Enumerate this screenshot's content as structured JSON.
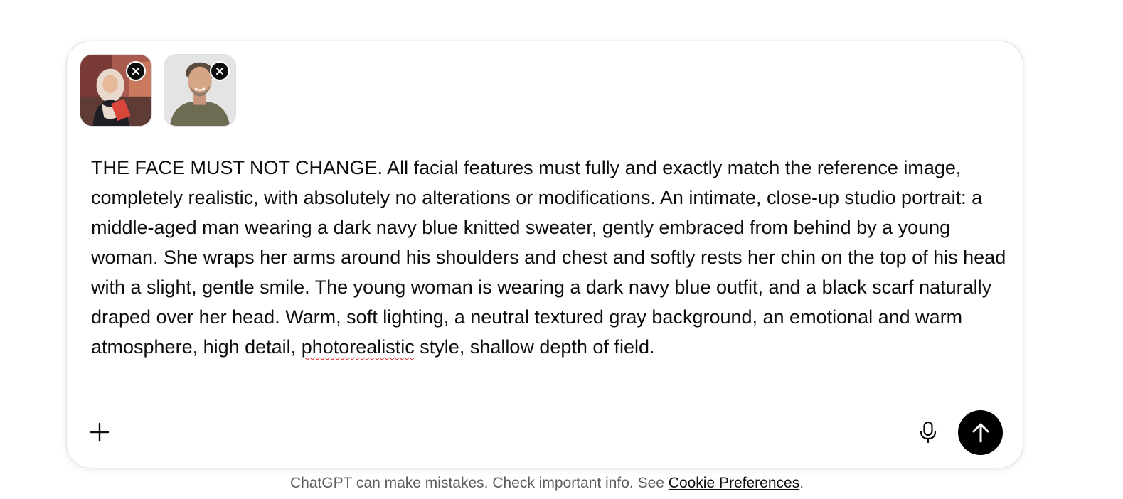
{
  "attachments": [
    {
      "icon": "image-thumbnail-woman",
      "remove_icon": "close-icon"
    },
    {
      "icon": "image-thumbnail-man",
      "remove_icon": "close-icon"
    }
  ],
  "prompt": {
    "text_main": "THE FACE MUST NOT CHANGE. All facial features must fully and exactly match the reference image, completely realistic, with absolutely no alterations or modifications. An intimate, close-up studio portrait: a middle-aged man wearing a dark navy blue knitted sweater, gently embraced from behind by a young woman. She wraps her arms around his shoulders and chest and softly rests her chin on the top of his head with a slight, gentle smile. The young woman is wearing a dark navy blue outfit, and a black scarf naturally draped over her head. Warm, soft lighting, a neutral textured gray background, an emotional and warm atmosphere, high detail,",
    "misspelled_word": "photorealistic",
    "text_tail": " style, shallow depth of field."
  },
  "toolbar": {
    "plus_icon": "plus-icon",
    "mic_icon": "microphone-icon",
    "send_icon": "arrow-up-icon"
  },
  "footer": {
    "text": "ChatGPT can make mistakes. Check important info. See ",
    "link_label": "Cookie Preferences",
    "suffix": "."
  },
  "colors": {
    "send_button": "#000000",
    "spellcheck_underline": "#e02424",
    "disclaimer_text": "#5d5d5d"
  }
}
